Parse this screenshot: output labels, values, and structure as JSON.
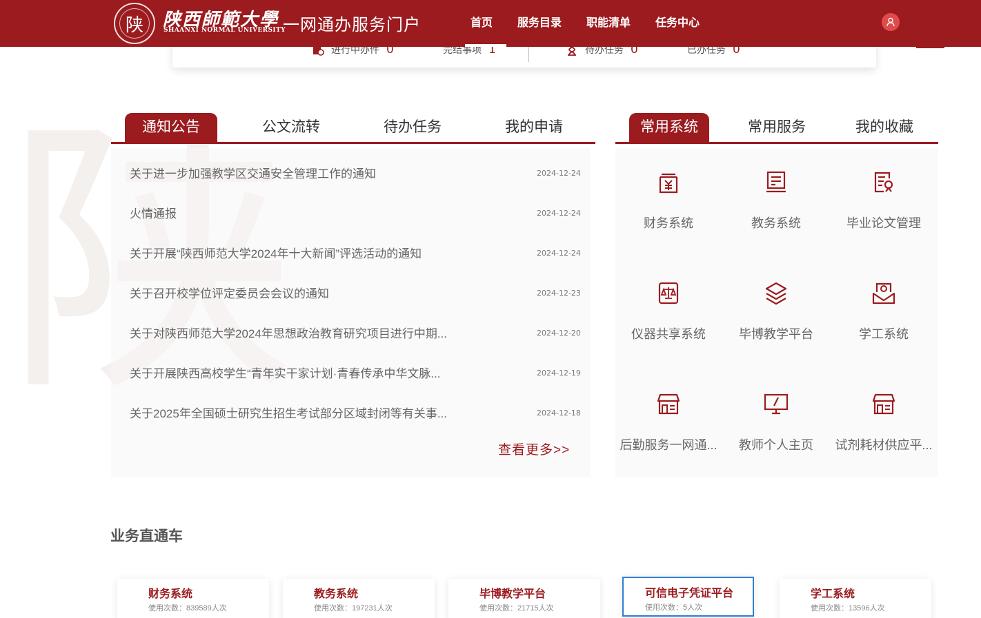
{
  "header": {
    "logo_seal_char": "陕",
    "logo_cn": "陕西師範大學",
    "logo_en": "SHAANXI NORMAL UNIVERSITY",
    "portal_title": "一网通办服务门户",
    "nav": [
      "首页",
      "服务目录",
      "职能清单",
      "任务中心"
    ],
    "active_nav": "首页",
    "user_icon": "user-icon"
  },
  "stats": {
    "in_progress_label": "进行中办件",
    "in_progress_value": "0",
    "completed_label": "完结事项",
    "completed_value": "1",
    "pending_label": "待办任务",
    "pending_value": "0",
    "done_label": "已办任务",
    "done_value": "0"
  },
  "news_panel": {
    "tabs": [
      "通知公告",
      "公文流转",
      "待办任务",
      "我的申请"
    ],
    "active_tab": "通知公告",
    "items": [
      {
        "title": "关于进一步加强教学区交通安全管理工作的通知",
        "date": "2024-12-24"
      },
      {
        "title": "火情通报",
        "date": "2024-12-24"
      },
      {
        "title": "关于开展“陕西师范大学2024年十大新闻”评选活动的通知",
        "date": "2024-12-24"
      },
      {
        "title": "关于召开校学位评定委员会会议的通知",
        "date": "2024-12-23"
      },
      {
        "title": "关于对陕西师范大学2024年思想政治教育研究项目进行中期...",
        "date": "2024-12-20"
      },
      {
        "title": "关于开展陕西高校学生“青年实干家计划·青春传承中华文脉...",
        "date": "2024-12-19"
      },
      {
        "title": "关于2025年全国硕士研究生招生考试部分区域封闭等有关事...",
        "date": "2024-12-18"
      }
    ],
    "more_label": "查看更多>>"
  },
  "systems_panel": {
    "tabs": [
      "常用系统",
      "常用服务",
      "我的收藏"
    ],
    "active_tab": "常用系统",
    "items": [
      {
        "label": "财务系统",
        "icon": "finance-icon"
      },
      {
        "label": "教务系统",
        "icon": "academic-affairs-icon"
      },
      {
        "label": "毕业论文管理",
        "icon": "thesis-icon"
      },
      {
        "label": "仪器共享系统",
        "icon": "instrument-scale-icon"
      },
      {
        "label": "毕博教学平台",
        "icon": "layers-icon"
      },
      {
        "label": "学工系统",
        "icon": "student-affairs-icon"
      },
      {
        "label": "后勤服务一网通...",
        "icon": "store-icon"
      },
      {
        "label": "教师个人主页",
        "icon": "monitor-icon"
      },
      {
        "label": "试剂耗材供应平...",
        "icon": "store-icon"
      }
    ]
  },
  "business": {
    "title": "业务直通车",
    "cards": [
      {
        "name": "财务系统",
        "usage": "使用次数：839589人次"
      },
      {
        "name": "教务系统",
        "usage": "使用次数：197231人次"
      },
      {
        "name": "毕博教学平台",
        "usage": "使用次数：21715人次"
      },
      {
        "name": "可信电子凭证平台",
        "usage": "使用次数：5人次"
      },
      {
        "name": "学工系统",
        "usage": "使用次数：13596人次"
      }
    ],
    "selected_card": "可信电子凭证平台"
  },
  "colors": {
    "brand": "#9b1b1f",
    "selected_border": "#2f7fd1",
    "user_badge": "#e14b4b"
  }
}
